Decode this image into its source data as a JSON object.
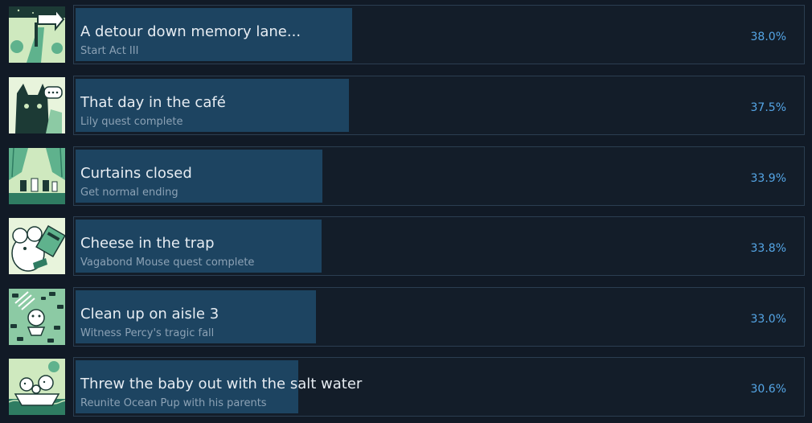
{
  "achievements": [
    {
      "title": "A detour down memory lane...",
      "description": "Start Act III",
      "percent_label": "38.0%",
      "percent": 38.0,
      "icon": "road-arrow-icon"
    },
    {
      "title": "That day in the café",
      "description": "Lily quest complete",
      "percent_label": "37.5%",
      "percent": 37.5,
      "icon": "cat-speech-icon"
    },
    {
      "title": "Curtains closed",
      "description": "Get normal ending",
      "percent_label": "33.9%",
      "percent": 33.9,
      "icon": "stage-curtain-icon"
    },
    {
      "title": "Cheese in the trap",
      "description": "Vagabond Mouse quest complete",
      "percent_label": "33.8%",
      "percent": 33.8,
      "icon": "mouse-trap-icon"
    },
    {
      "title": "Clean up on aisle 3",
      "description": "Witness Percy's tragic fall",
      "percent_label": "33.0%",
      "percent": 33.0,
      "icon": "falling-cans-icon"
    },
    {
      "title": "Threw the baby out with the salt water",
      "description": "Reunite Ocean Pup with his parents",
      "percent_label": "30.6%",
      "percent": 30.6,
      "icon": "boat-family-icon"
    }
  ],
  "colors": {
    "background": "#111a26",
    "card_border": "#2b3e51",
    "progress_fill": "#1d4461",
    "title": "#e6ecf2",
    "description": "#8ca2b5",
    "percent": "#55a6e6",
    "icon_light": "#cfe9bf",
    "icon_mid": "#5fb28d",
    "icon_dark": "#1c3a35"
  }
}
